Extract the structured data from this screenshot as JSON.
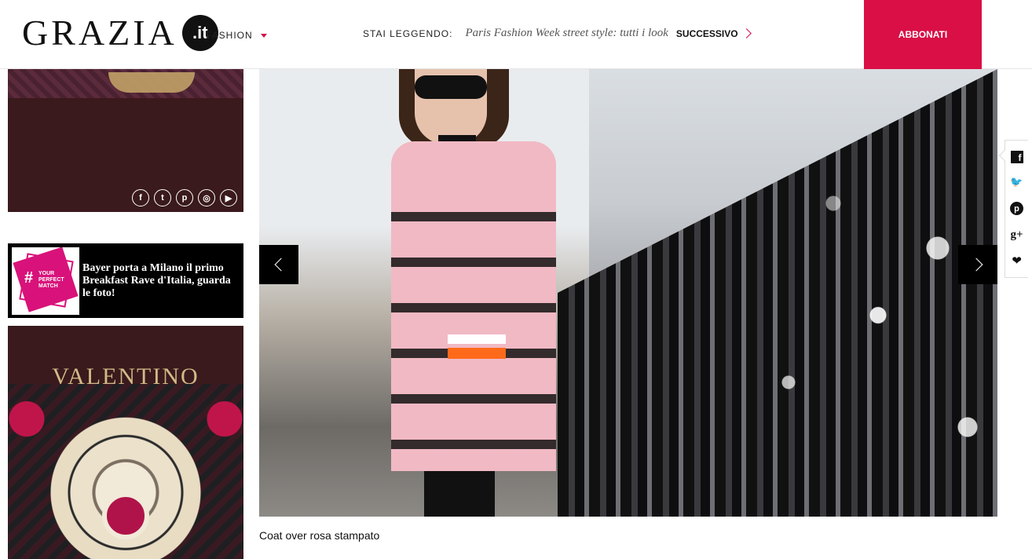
{
  "header": {
    "logo_word": "GRAZIA",
    "logo_suffix": ".it",
    "nav_section": "FASHION",
    "reading_label": "STAI LEGGENDO:",
    "reading_title": "Paris Fashion Week street style: tutti i look",
    "next_label": "SUCCESSIVO",
    "subscribe_label": "ABBONATI"
  },
  "sidebar": {
    "social_icons": [
      "facebook-icon",
      "twitter-icon",
      "pinterest-icon",
      "instagram-icon",
      "youtube-icon"
    ],
    "promo": {
      "thumb_hash": "#",
      "thumb_text": "YOUR PERFECT MATCH",
      "text": "Bayer porta a Milano il primo Breakfast Rave d'Italia, guarda le foto!"
    },
    "ad_brand": "VALENTINO"
  },
  "gallery": {
    "caption": "Coat over rosa stampato",
    "prev_icon": "chevron-left-icon",
    "next_icon": "chevron-right-icon"
  },
  "share": {
    "facebook_glyph": "f",
    "twitter_glyph": "🐦",
    "pinterest_glyph": "p",
    "googleplus_glyph": "g+",
    "heart_glyph": "❤"
  },
  "colors": {
    "accent": "#d90f46",
    "ad_background": "#3a1a1c"
  }
}
